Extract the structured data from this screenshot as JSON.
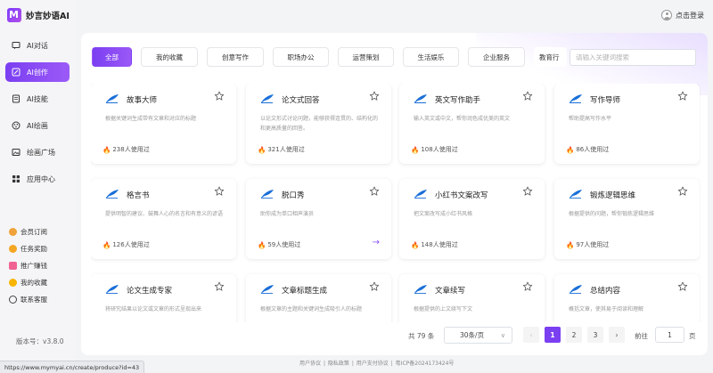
{
  "app": {
    "name": "妙言妙语AI"
  },
  "header": {
    "login_label": "点击登录"
  },
  "sidebar": {
    "items": [
      {
        "label": "AI对话",
        "icon": "chat-icon"
      },
      {
        "label": "AI创作",
        "icon": "create-icon",
        "active": true
      },
      {
        "label": "AI技能",
        "icon": "skill-icon"
      },
      {
        "label": "AI绘画",
        "icon": "paint-icon"
      },
      {
        "label": "绘画广场",
        "icon": "gallery-icon"
      },
      {
        "label": "应用中心",
        "icon": "apps-icon"
      }
    ],
    "secondary": [
      {
        "label": "会员订阅",
        "icon": "crown-icon",
        "color": "#f0a23a"
      },
      {
        "label": "任务奖励",
        "icon": "gift-icon",
        "color": "#f5a623"
      },
      {
        "label": "推广赚钱",
        "icon": "promote-icon",
        "color": "#f06292"
      },
      {
        "label": "我的收藏",
        "icon": "favorite-icon",
        "color": "#f7b500"
      },
      {
        "label": "联系客服",
        "icon": "headset-icon",
        "color": "#444444"
      }
    ],
    "version": "版本号：v3.8.0"
  },
  "tabs": [
    {
      "label": "全部",
      "active": true
    },
    {
      "label": "我的收藏"
    },
    {
      "label": "创意写作"
    },
    {
      "label": "职场办公"
    },
    {
      "label": "运营策划"
    },
    {
      "label": "生活娱乐"
    },
    {
      "label": "企业服务"
    },
    {
      "label": "教育行"
    }
  ],
  "search": {
    "placeholder": "请输入关键词搜索"
  },
  "cards": [
    {
      "title": "故事大师",
      "desc": "根据关键词生成带有文章和对应的标题",
      "usage": "238人使用过"
    },
    {
      "title": "论文式回答",
      "desc": "以论文形式讨论问题，能够获得连贯的、结构化的和更高质量的回答。",
      "usage": "321人使用过"
    },
    {
      "title": "英文写作助手",
      "desc": "输入英文或中文，帮你润色成优美的英文",
      "usage": "108人使用过"
    },
    {
      "title": "写作导师",
      "desc": "帮助提高写作水平",
      "usage": "86人使用过"
    },
    {
      "title": "格言书",
      "desc": "提供明智的建议、鼓舞人心的名言和有意义的谚语",
      "usage": "126人使用过"
    },
    {
      "title": "脱口秀",
      "desc": "助你成为单口相声演员",
      "usage": "59人使用过",
      "arrow": "→"
    },
    {
      "title": "小红书文案改写",
      "desc": "把文案改写成小红书风格",
      "usage": "148人使用过"
    },
    {
      "title": "锻炼逻辑思维",
      "desc": "根据提供的问题，帮你锻炼逻辑思维",
      "usage": "97人使用过"
    },
    {
      "title": "论文生成专家",
      "desc": "将研究结果以论文或文章的形式呈现出来",
      "usage": ""
    },
    {
      "title": "文章标题生成",
      "desc": "根据文章的主题和关键词生成吸引人的标题",
      "usage": ""
    },
    {
      "title": "文章续写",
      "desc": "根据提供的上文续写下文",
      "usage": ""
    },
    {
      "title": "总结内容",
      "desc": "概括文章，使其易于阅读和理解",
      "usage": ""
    }
  ],
  "pagination": {
    "total": "共 79 条",
    "page_size": "30条/页",
    "prev": "‹",
    "pages": [
      "1",
      "2",
      "3"
    ],
    "current": "1",
    "next": "›",
    "goto_label": "前往",
    "goto_value": "1",
    "page_unit": "页"
  },
  "footer": {
    "links": [
      "用户协议",
      "隐私政策",
      "用户支付协议",
      "粤ICP备2024173424号"
    ],
    "separator": "|"
  },
  "status_url": "https://www.mymyai.cn/create/produce?id=43",
  "colors": {
    "accent": "#7b3ff2",
    "feather": "#1a6fd8",
    "fire": "#f5781e"
  }
}
